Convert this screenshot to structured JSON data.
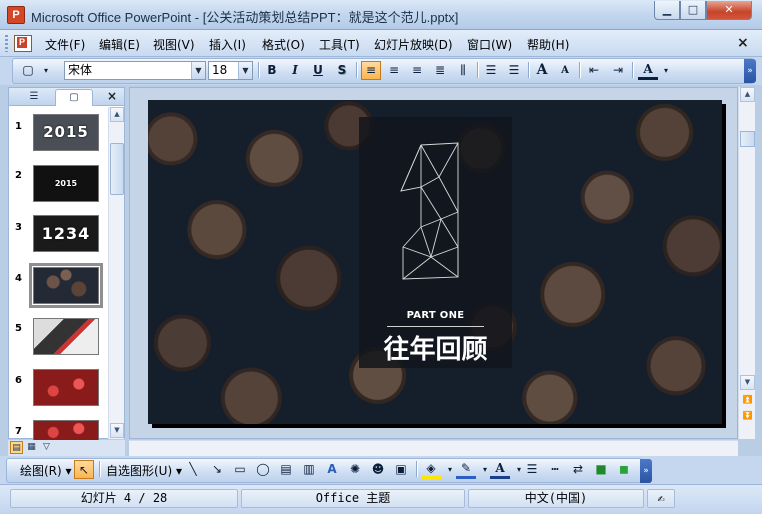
{
  "window": {
    "title": "Microsoft Office PowerPoint - [公关活动策划总结PPT：就是这个范儿.pptx]",
    "app_icon_letter": "P",
    "minimize": "▁",
    "maximize": "□",
    "close": "✕"
  },
  "menu": {
    "items": [
      "文件(F)",
      "编辑(E)",
      "视图(V)",
      "插入(I)",
      "格式(O)",
      "工具(T)",
      "幻灯片放映(D)",
      "窗口(W)",
      "帮助(H)"
    ],
    "close": "×"
  },
  "toolbar": {
    "font_name": "宋体",
    "font_size": "18",
    "bold": "B",
    "italic": "I",
    "underline": "U",
    "shadow": "S",
    "align_left": "≡",
    "align_center": "≡",
    "align_right": "≡",
    "distribute": "⫼",
    "numbering": "☰",
    "bullets": "☰",
    "increase_font": "A",
    "decrease_font": "A",
    "decrease_indent": "⇤",
    "increase_indent": "⇥",
    "font_color": "A",
    "overflow": "»"
  },
  "pane": {
    "tab_outline": "☰",
    "tab_slides": "▢",
    "close": "×",
    "slides": [
      {
        "num": "1",
        "label": "2015"
      },
      {
        "num": "2",
        "label": "2015"
      },
      {
        "num": "3",
        "label": "1234"
      },
      {
        "num": "4",
        "label": ""
      },
      {
        "num": "5",
        "label": ""
      },
      {
        "num": "6",
        "label": ""
      },
      {
        "num": "7",
        "label": ""
      }
    ],
    "selected_slide": 4
  },
  "slide": {
    "part_label": "PART ONE",
    "heading": "往年回顾",
    "big_number": "1"
  },
  "colors": {
    "accent": "#fbb54e",
    "title_bar": "#c3d6ee",
    "slide_panel": "#12161c"
  },
  "drawing_toolbar": {
    "draw_label": "绘图(R)",
    "autoshapes_label": "自选图形(U)"
  },
  "status": {
    "slide_info": "幻灯片 4 / 28",
    "theme": "Office 主题",
    "language": "中文(中国)"
  }
}
